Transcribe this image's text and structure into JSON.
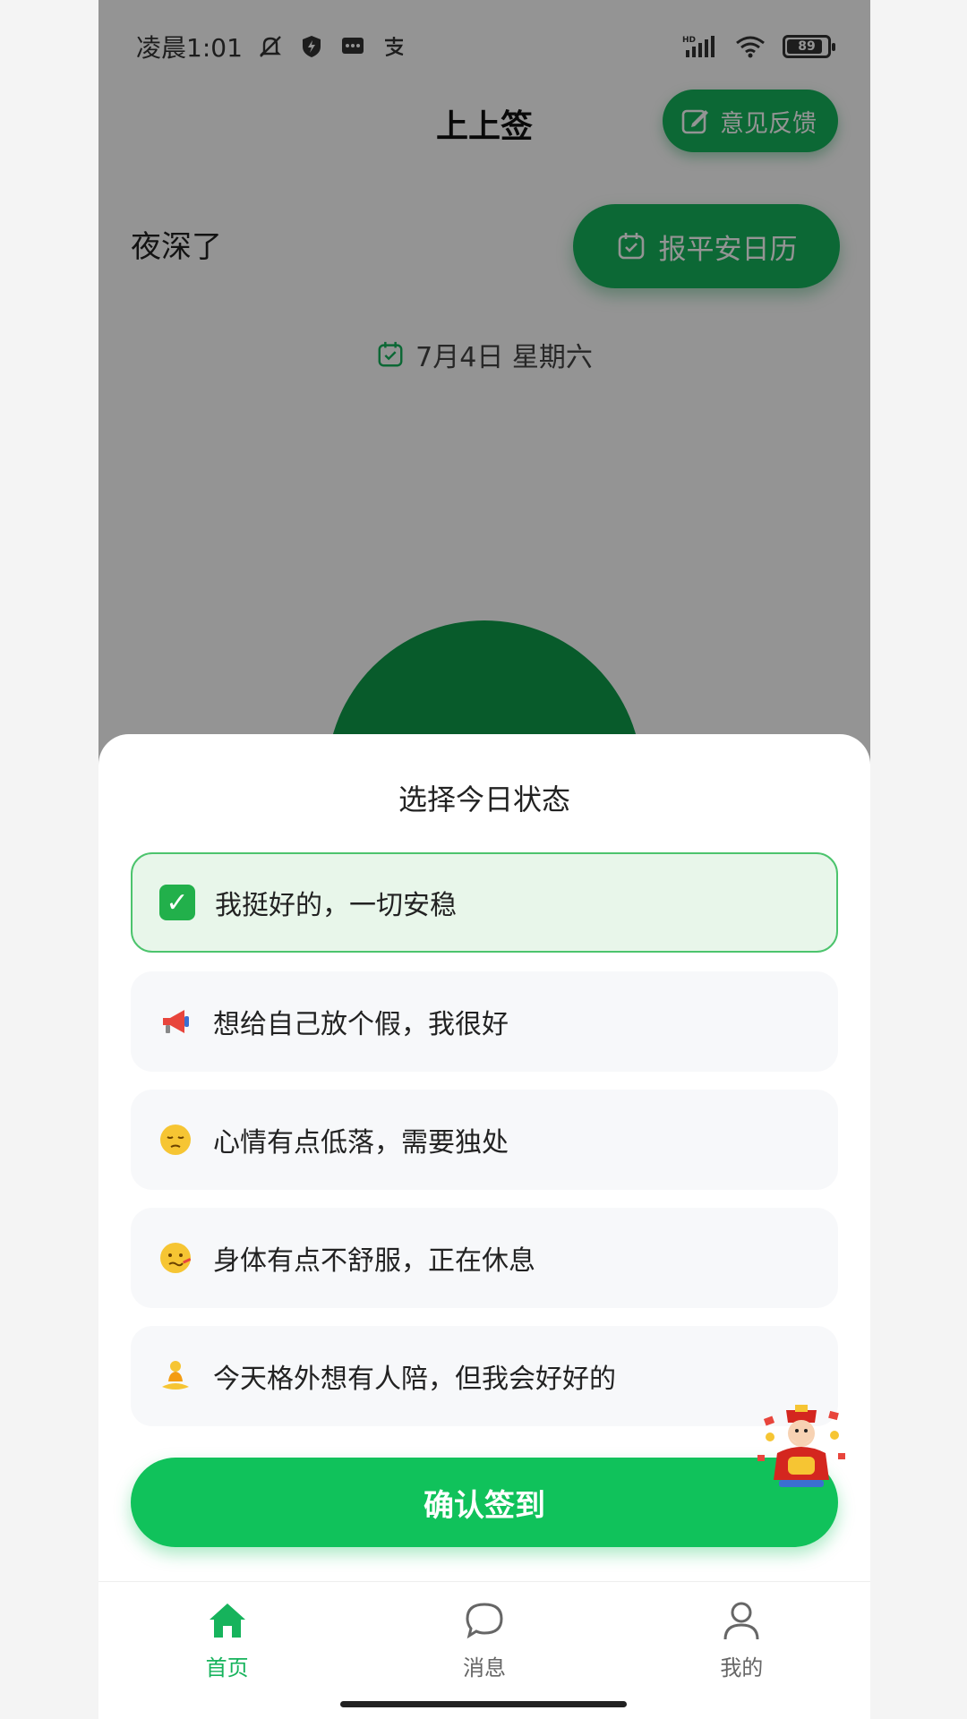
{
  "status_bar": {
    "time": "凌晨1:01",
    "battery": "89",
    "battery_level": 0.89
  },
  "header": {
    "title": "上上签",
    "feedback_label": "意见反馈"
  },
  "home": {
    "greeting": "夜深了",
    "calendar_label": "报平安日历",
    "date": "7月4日 星期六"
  },
  "sheet": {
    "title": "选择今日状态",
    "options": [
      {
        "label": "我挺好的，一切安稳",
        "icon": "check-mark-emoji",
        "selected": true
      },
      {
        "label": "想给自己放个假，我很好",
        "icon": "megaphone-emoji",
        "selected": false
      },
      {
        "label": "心情有点低落，需要独处",
        "icon": "pensive-face-emoji",
        "selected": false
      },
      {
        "label": "身体有点不舒服，正在休息",
        "icon": "sick-face-emoji",
        "selected": false
      },
      {
        "label": "今天格外想有人陪，但我会好好的",
        "icon": "meditating-person-emoji",
        "selected": false
      }
    ],
    "confirm_label": "确认签到"
  },
  "tabs": [
    {
      "label": "首页",
      "icon": "home-icon",
      "active": true
    },
    {
      "label": "消息",
      "icon": "chat-icon",
      "active": false
    },
    {
      "label": "我的",
      "icon": "profile-icon",
      "active": false
    }
  ],
  "colors": {
    "primary": "#16b35c",
    "confirm": "#10c25b",
    "selected_bg": "#e8f6ea",
    "selected_border": "#4cc46d"
  }
}
